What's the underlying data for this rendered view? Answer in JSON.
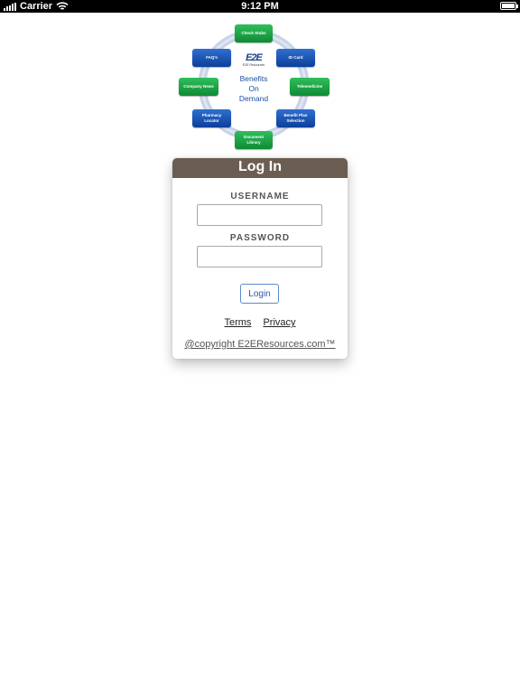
{
  "status_bar": {
    "carrier": "Carrier",
    "time": "9:12 PM"
  },
  "logo": {
    "brand_mark": "E2E",
    "brand_sub": "E2E Resources",
    "center_line1": "Benefits",
    "center_line2": "On",
    "center_line3": "Demand",
    "items": {
      "check_stubs": "Check Stubs",
      "id_card": "ID Card",
      "telemedicine": "Telemedicine",
      "benefit_plan_selection": "Benefit Plan Selection",
      "document_library": "Document Library",
      "pharmacy_locator": "Pharmacy Locator",
      "company_news": "Company News",
      "faqs": "FAQ's"
    },
    "colors": {
      "green": "#12913a",
      "blue": "#0f44a0",
      "ring": "#c9d3e8"
    }
  },
  "login": {
    "title": "Log In",
    "username_label": "USERNAME",
    "username_value": "",
    "password_label": "PASSWORD",
    "password_value": "",
    "login_button": "Login",
    "terms_link": "Terms",
    "privacy_link": "Privacy",
    "copyright": "@copyright E2EResources.com™"
  },
  "colors": {
    "header": "#6b5d51",
    "button_border": "#5a8ccc"
  }
}
